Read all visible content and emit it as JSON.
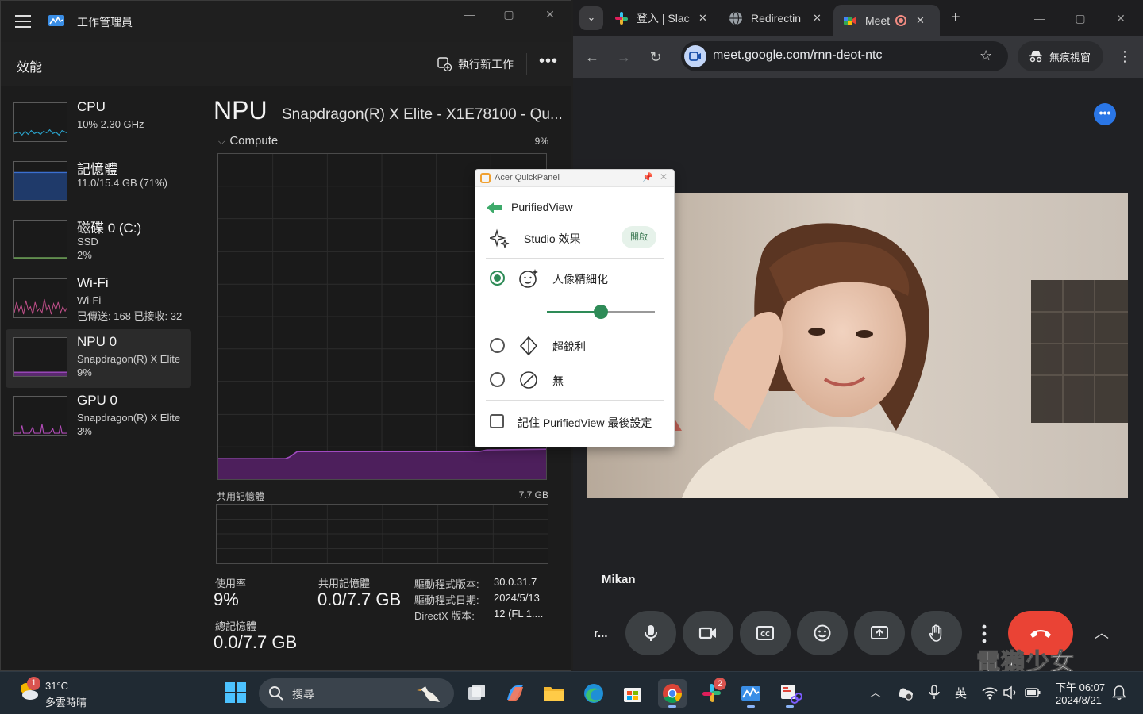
{
  "task_manager": {
    "title": "工作管理員",
    "window_controls": {
      "minimize": "—",
      "maximize": "▢",
      "close": "✕"
    },
    "section_title": "效能",
    "run_new_task_label": "執行新工作",
    "more_label": "•••",
    "perf_items": [
      {
        "name": "CPU",
        "line1": "10%  2.30 GHz",
        "line2": "",
        "graph_color": "#2aa0c8"
      },
      {
        "name": "記憶體",
        "line1": "11.0/15.4 GB (71%)",
        "line2": "",
        "graph_color": "#3a6fd0"
      },
      {
        "name": "磁碟 0 (C:)",
        "line1": "SSD",
        "line2": "2%",
        "graph_color": "#7bb661"
      },
      {
        "name": "Wi-Fi",
        "line1": "Wi-Fi",
        "line2": "已傳送: 168  已接收: 32",
        "graph_color": "#c14f8a"
      },
      {
        "name": "NPU 0",
        "line1": "Snapdragon(R) X Elite",
        "line2": "9%",
        "graph_color": "#a04ac0"
      },
      {
        "name": "GPU 0",
        "line1": "Snapdragon(R) X Elite",
        "line2": "3%",
        "graph_color": "#b24bb8"
      }
    ],
    "npu": {
      "title": "NPU",
      "device": "Snapdragon(R) X Elite - X1E78100 - Qu...",
      "compute_label": "Compute",
      "compute_percent": "9%",
      "shared_memory_label": "共用記憶體",
      "shared_memory_total": "7.7 GB",
      "stats": {
        "utilization_label": "使用率",
        "utilization_value": "9%",
        "shared_label": "共用記憶體",
        "shared_value": "0.0/7.7 GB",
        "total_label": "總記憶體",
        "total_value": "0.0/7.7 GB"
      },
      "driver": {
        "version_label": "驅動程式版本:",
        "version_value": "30.0.31.7",
        "date_label": "驅動程式日期:",
        "date_value": "2024/5/13",
        "directx_label": "DirectX 版本:",
        "directx_value": "12 (FL 1...."
      }
    }
  },
  "quick_panel": {
    "title": "Acer QuickPanel",
    "heading": "PurifiedView",
    "studio_label": "Studio 效果",
    "studio_badge": "開啟",
    "options": [
      {
        "label": "人像精細化",
        "checked": true,
        "icon": "face-sparkle-icon"
      },
      {
        "label": "超銳利",
        "checked": false,
        "icon": "sharpen-icon"
      },
      {
        "label": "無",
        "checked": false,
        "icon": "none-icon"
      }
    ],
    "slider_value": 0.5,
    "remember_label": "記住 PurifiedView 最後設定",
    "accent_color": "#2e8b57"
  },
  "chrome": {
    "tabs": [
      {
        "label": "登入 | Slac",
        "icon": "slack-icon"
      },
      {
        "label": "Redirectin",
        "icon": "globe-icon"
      },
      {
        "label": "Meet",
        "icon": "meet-icon",
        "active": true
      }
    ],
    "new_tab_label": "+",
    "url": "meet.google.com/rnn-deot-ntc",
    "incognito_label": "無痕視窗",
    "window_controls": {
      "minimize": "—",
      "maximize": "▢",
      "close": "✕"
    }
  },
  "meet": {
    "participant_name": "Mikan",
    "meeting_code_short": "r...",
    "more_label": "•••",
    "controls": [
      "microphone",
      "camera",
      "captions",
      "emoji",
      "present",
      "raise-hand",
      "more",
      "leave"
    ],
    "leave_color": "#ea4335",
    "watermark_text": "電獺少女"
  },
  "taskbar": {
    "weather_badge": "1",
    "weather_temp": "31°C",
    "weather_desc": "多雲時晴",
    "search_label": "搜尋",
    "slack_badge": "2",
    "ime_label": "英",
    "clock_time": "下午 06:07",
    "clock_date": "2024/8/21"
  }
}
